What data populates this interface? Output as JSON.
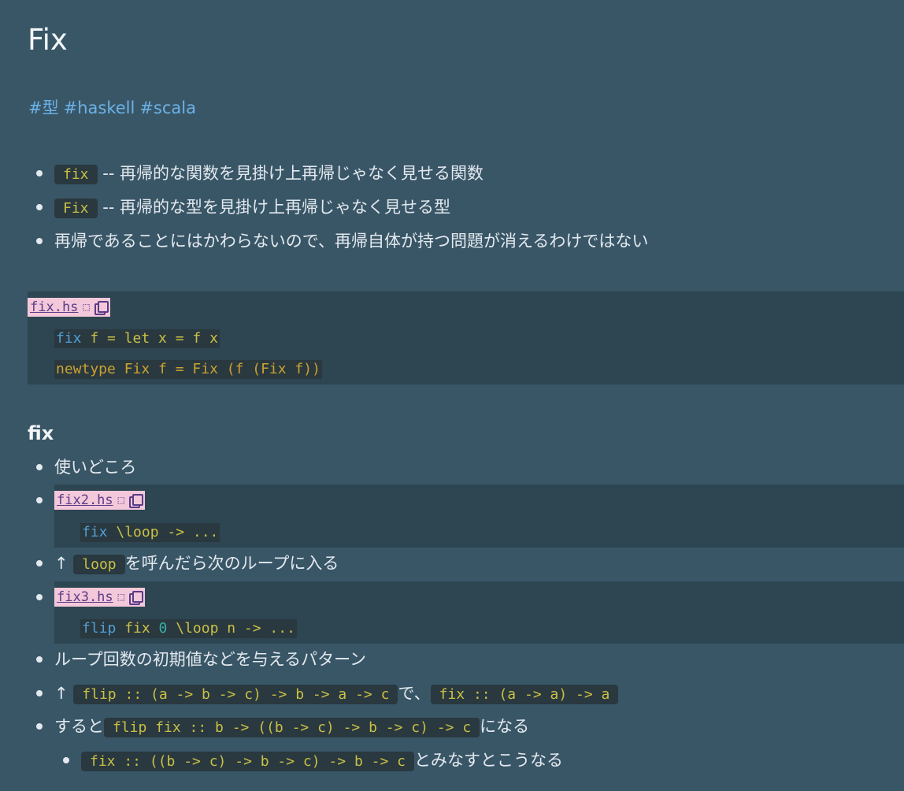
{
  "page": {
    "title": "Fix",
    "tags": [
      "#型",
      "#haskell",
      "#scala"
    ]
  },
  "intro": {
    "items": [
      {
        "code": "fix",
        "text": "-- 再帰的な関数を見掛け上再帰じゃなく見せる関数"
      },
      {
        "code": "Fix",
        "text": "-- 再帰的な型を見掛け上再帰じゃなく見せる型"
      },
      {
        "text": "再帰であることにはかわらないので、再帰自体が持つ問題が消えるわけではない"
      }
    ]
  },
  "block1": {
    "filename": "fix.hs",
    "glyph": "⬚",
    "lines": [
      [
        {
          "t": "fix",
          "c": "kw"
        },
        {
          "t": " f = let x = f x",
          "c": "id"
        }
      ],
      [
        {
          "t": "newtype",
          "c": "ty"
        },
        {
          "t": " Fix f = Fix (f (Fix f))",
          "c": "ty"
        }
      ]
    ]
  },
  "section_fix": {
    "heading": "fix",
    "item1": "使いどころ",
    "block2": {
      "filename": "fix2.hs",
      "glyph": "⬚",
      "lines": [
        [
          {
            "t": "fix",
            "c": "kw"
          },
          {
            "t": " \\loop -> ...",
            "c": "id"
          }
        ]
      ]
    },
    "item3": {
      "prefix": "↑",
      "code": "loop",
      "text": "を呼んだら次のループに入る"
    },
    "block3": {
      "filename": "fix3.hs",
      "glyph": "⬚",
      "lines": [
        [
          {
            "t": "flip",
            "c": "kw"
          },
          {
            "t": " fix ",
            "c": "id"
          },
          {
            "t": "0",
            "c": "num"
          },
          {
            "t": " \\loop n -> ...",
            "c": "id"
          }
        ]
      ]
    },
    "item5": "ループ回数の初期値などを与えるパターン",
    "item6": {
      "prefix": "↑",
      "code1": "flip :: (a -> b -> c) -> b -> a -> c",
      "mid": "で、",
      "code2": "fix :: (a -> a) -> a"
    },
    "item7": {
      "prefix": "すると",
      "code": "flip fix :: b -> ((b -> c) -> b -> c) -> c",
      "suffix": "になる"
    },
    "item8": {
      "code": "fix :: ((b -> c) -> b -> c) -> b -> c",
      "suffix": "とみなすとこうなる"
    }
  }
}
